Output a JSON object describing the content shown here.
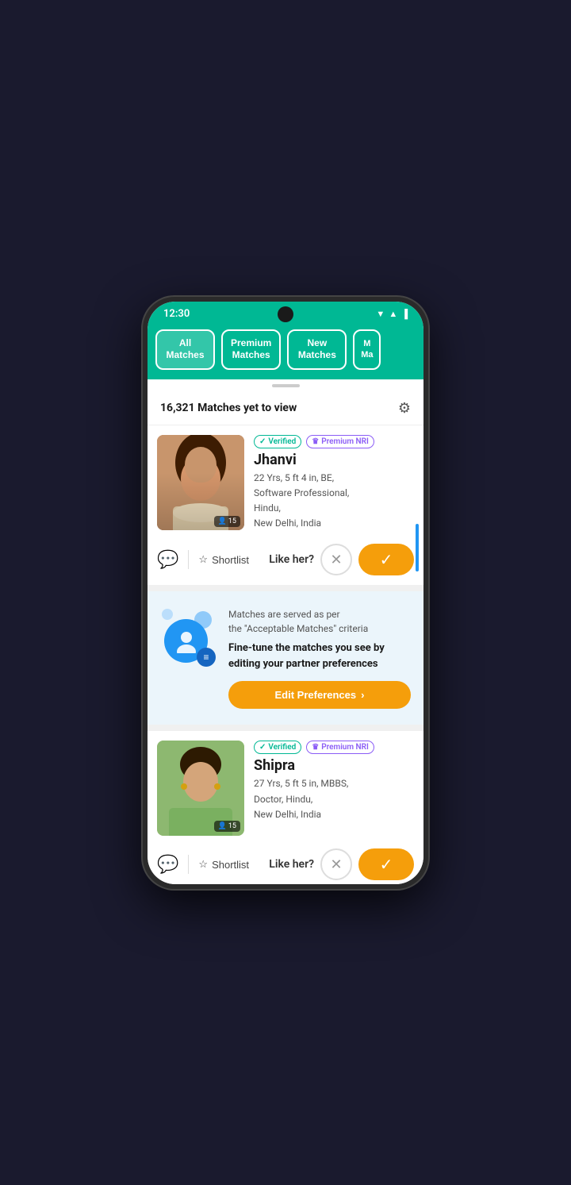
{
  "status_bar": {
    "time": "12:30",
    "wifi_icon": "▲",
    "signal_icon": "▲",
    "battery_icon": "▐"
  },
  "tabs": [
    {
      "id": "all",
      "label": "All\nMatches",
      "active": true
    },
    {
      "id": "premium",
      "label": "Premium\nMatches",
      "active": false
    },
    {
      "id": "new",
      "label": "New\nMatches",
      "active": false
    },
    {
      "id": "more",
      "label": "M\nMa",
      "partial": true
    }
  ],
  "match_count": {
    "text": "16,321 Matches yet to view"
  },
  "profiles": [
    {
      "id": "jhanvi",
      "name": "Jhanvi",
      "verified_label": "Verified",
      "premium_label": "Premium NRI",
      "details": "22 Yrs, 5 ft 4 in, BE,\nSoftware Professional,\nHindu,\nNew Delhi, India",
      "photo_count": "15",
      "like_label": "Like her?",
      "shortlist_label": "Shortlist"
    },
    {
      "id": "shipra",
      "name": "Shipra",
      "verified_label": "Verified",
      "premium_label": "Premium NRI",
      "details": "27 Yrs, 5 ft 5 in, MBBS,\nDoctor, Hindu,\nNew Delhi, India",
      "photo_count": "15",
      "like_label": "Like her?",
      "shortlist_label": "Shortlist"
    }
  ],
  "info_banner": {
    "subtitle": "Matches are served as per\nthe \"Acceptable Matches\" criteria",
    "title": "Fine-tune the matches you see by\nediting your partner preferences",
    "edit_btn_label": "Edit Preferences",
    "edit_btn_arrow": "›"
  },
  "icons": {
    "verified_check": "✓",
    "premium_crown": "♛",
    "chat": "💬",
    "star": "☆",
    "close": "✕",
    "check": "✓",
    "filter": "⚙",
    "settings_sliders": "≡",
    "photo_icon": "👤"
  }
}
